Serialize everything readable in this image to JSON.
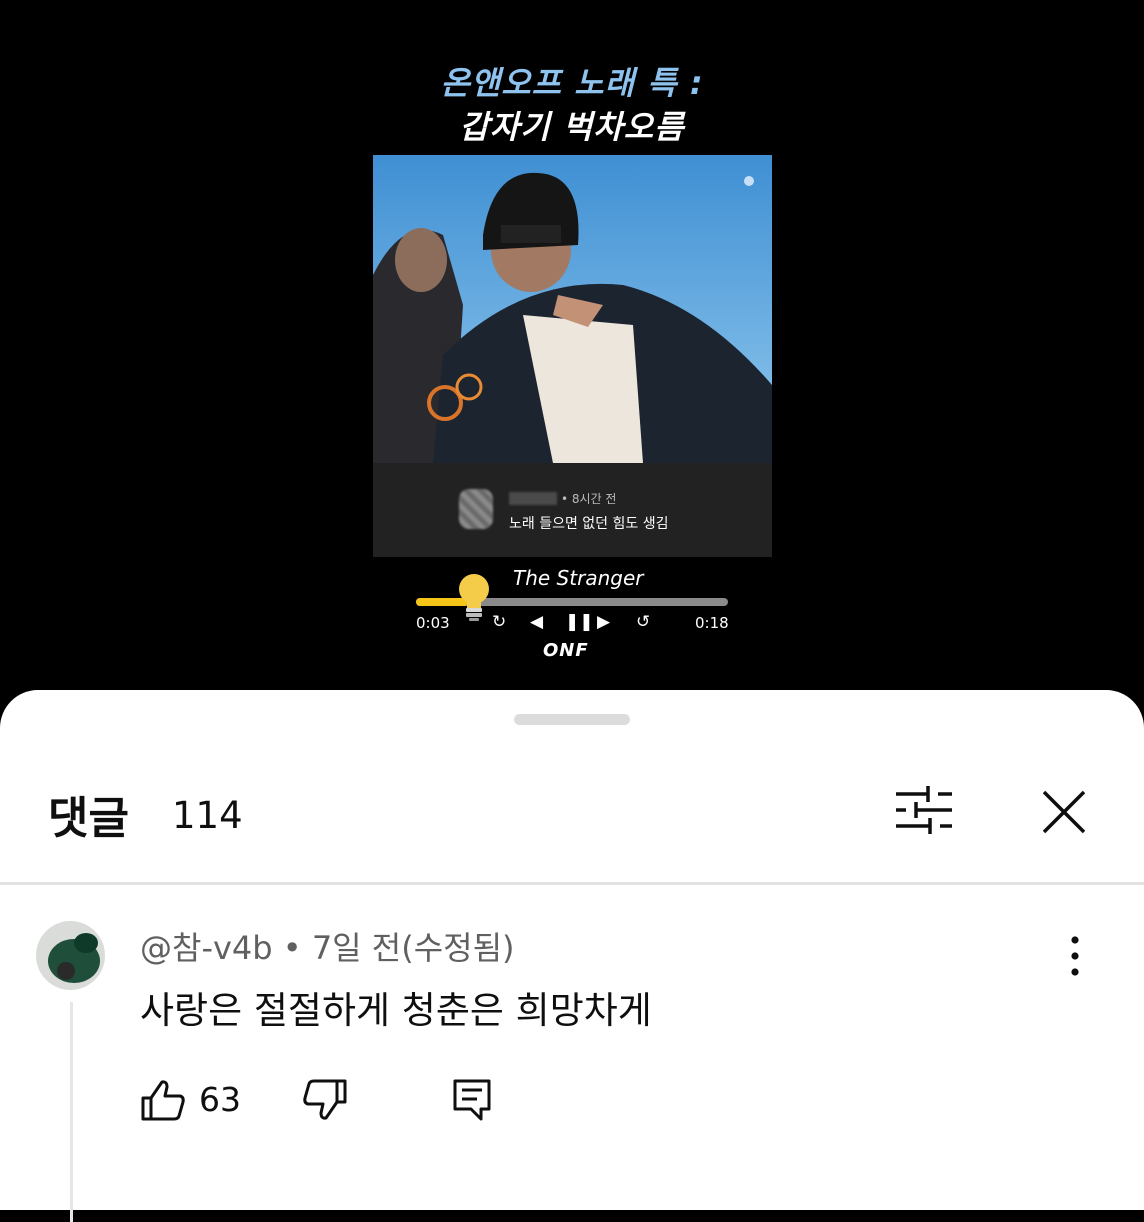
{
  "video": {
    "caption_line1": "온앤오프 노래 특 :",
    "caption_line2": "갑자기 벅차오름",
    "inner_comment": {
      "time": "• 8시간 전",
      "text": "노래 들으면 없던 힘도 생김"
    },
    "player": {
      "song_title": "The Stranger",
      "current_time": "0:03",
      "total_time": "0:18",
      "progress_fraction": 0.167,
      "accent_color": "#f5c518",
      "logo": "ONF"
    }
  },
  "comments_panel": {
    "title": "댓글",
    "count": "114",
    "icons": [
      "sliders-icon",
      "close-icon"
    ],
    "comment": {
      "meta": "@참-v4b • 7일 전(수정됨)",
      "text": "사랑은 절절하게 청춘은 희망차게",
      "like_count": "63"
    }
  }
}
